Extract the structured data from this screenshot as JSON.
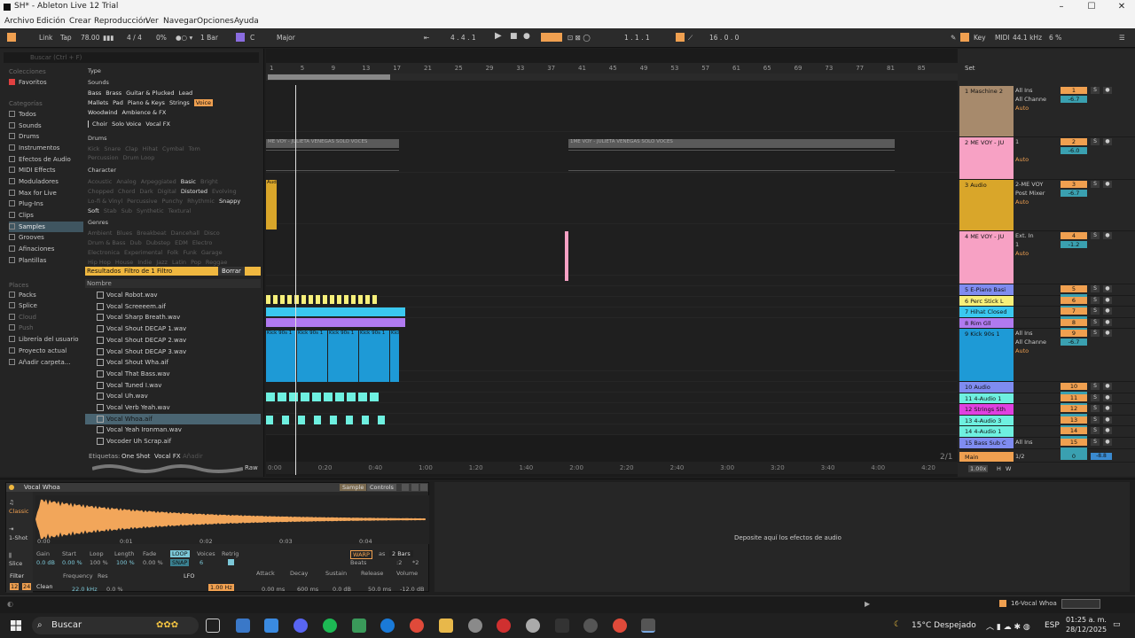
{
  "window": {
    "title": "SH* - Ableton Live 12 Trial"
  },
  "menu": [
    "Archivo",
    "Edición",
    "Crear",
    "Reproducción",
    "Ver",
    "Navegar",
    "Opciones",
    "Ayuda"
  ],
  "control_bar": {
    "link": "Link",
    "tap": "Tap",
    "tempo": "78.00",
    "signature": "4 / 4",
    "swing": "0%",
    "quantize": "1 Bar",
    "key": "C",
    "scale": "Major",
    "position": "4 . 4 . 1",
    "loop_start": "1 . 1 . 1",
    "loop_length": "16 . 0 . 0",
    "key_map": "Key",
    "midi": "MIDI",
    "sample_rate": "44.1 kHz",
    "cpu": "6 %"
  },
  "browser": {
    "search_placeholder": "Buscar (Ctrl + F)",
    "collections_header": "Colecciones",
    "collections": [
      "Favoritos"
    ],
    "categories_header": "Categorías",
    "categories": [
      "Todos",
      "Sounds",
      "Drums",
      "Instrumentos",
      "Efectos de Audio",
      "MIDI Effects",
      "Moduladores",
      "Max for Live",
      "Plug-Ins",
      "Clips",
      "Samples",
      "Grooves",
      "Afinaciones",
      "Plantillas"
    ],
    "selected_category": "Samples",
    "places_header": "Places",
    "places": [
      "Packs",
      "Splice",
      "Cloud",
      "Push",
      "Librería del usuario",
      "Proyecto actual",
      "Añadir carpeta..."
    ],
    "filter_type": "Type",
    "filter_sounds": "Sounds",
    "sounds_rows": [
      [
        "Bass",
        "Brass",
        "Guitar & Plucked",
        "Lead"
      ],
      [
        "Mallets",
        "Pad",
        "Piano & Keys",
        "Strings",
        "Voice"
      ],
      [
        "Woodwind",
        "Ambience & FX"
      ]
    ],
    "voice_sub": [
      "Choir",
      "Solo Voice",
      "Vocal FX"
    ],
    "filter_drums": "Drums",
    "drums_rows": [
      [
        "Kick",
        "Snare",
        "Clap",
        "Hihat",
        "Cymbal",
        "Tom"
      ],
      [
        "Percussion",
        "Drum Loop"
      ]
    ],
    "filter_character": "Character",
    "character_rows": [
      [
        "Acoustic",
        "Analog",
        "Arpeggiated",
        "Basic",
        "Bright"
      ],
      [
        "Chopped",
        "Chord",
        "Dark",
        "Digital",
        "Distorted",
        "Evolving"
      ],
      [
        "Lo-fi & Vinyl",
        "Percussive",
        "Punchy",
        "Rhythmic",
        "Snappy"
      ],
      [
        "Soft",
        "Stab",
        "Sub",
        "Synthetic",
        "Textural"
      ]
    ],
    "filter_genres": "Genres",
    "genres_rows": [
      [
        "Ambient",
        "Blues",
        "Breakbeat",
        "Dancehall",
        "Disco"
      ],
      [
        "Drum & Bass",
        "Dub",
        "Dubstep",
        "EDM",
        "Electro"
      ],
      [
        "Electronica",
        "Experimental",
        "Folk",
        "Funk",
        "Garage"
      ],
      [
        "Hip Hop",
        "House",
        "Indie",
        "Jazz",
        "Latin",
        "Pop",
        "Reggae"
      ]
    ],
    "results_label": "Resultados",
    "filter_count": "Filtro de 1 Filtro",
    "clear_label": "Borrar",
    "name_header": "Nombre",
    "files": [
      "Vocal Robot.wav",
      "Vocal Screeeem.aif",
      "Vocal Sharp Breath.wav",
      "Vocal Shout DECAP 1.wav",
      "Vocal Shout DECAP 2.wav",
      "Vocal Shout DECAP 3.wav",
      "Vocal Shout Wha.aif",
      "Vocal That Bass.wav",
      "Vocal Tuned I.wav",
      "Vocal Uh.wav",
      "Vocal Verb Yeah.wav",
      "Vocal Whoa.aif",
      "Vocal Yeah Ironman.wav",
      "Vocoder Uh Scrap.aif"
    ],
    "selected_file": "Vocal Whoa.aif",
    "tags_label": "Etiquetas:",
    "tags": [
      "One Shot",
      "Vocal FX",
      "Añadir"
    ],
    "raw_label": "Raw"
  },
  "arrangement": {
    "bar_ruler": [
      "1",
      "5",
      "9",
      "13",
      "17",
      "21",
      "25",
      "29",
      "33",
      "37",
      "41",
      "45",
      "49",
      "53",
      "57",
      "61",
      "65",
      "69",
      "73",
      "77",
      "81",
      "85"
    ],
    "time_ruler": [
      "0:00",
      "0:20",
      "0:40",
      "1:00",
      "1:20",
      "1:40",
      "2:00",
      "2:20",
      "2:40",
      "3:00",
      "3:20",
      "3:40",
      "4:00",
      "4:20"
    ],
    "page": "2/1",
    "clip_labels": [
      "ME VOY - JULIETA VENEGAS SOLO VOCES",
      "1ME VOY - JULIETA VENEGAS SOLO VOCES",
      "Aud",
      "Kick 90s 1",
      "Kick 90s 1",
      "Kick 90s 1",
      "Kick 90s 1",
      "Kick 90s 1"
    ]
  },
  "mixer": {
    "set_label": "Set",
    "tracks": [
      {
        "name": "1 Maschine 2",
        "input": "All Ins",
        "channel": "All Channe",
        "mon": "Auto",
        "num": "1",
        "vol": "-6.7",
        "color": "#a78a6c"
      },
      {
        "name": "2 ME VOY - JU",
        "input": "1",
        "channel": "",
        "mon": "Auto",
        "num": "2",
        "vol": "-6.0",
        "color": "#f7a1c4"
      },
      {
        "name": "3 Audio",
        "input": "2-ME VOY",
        "channel": "Post Mixer",
        "mon": "Auto",
        "num": "3",
        "vol": "-6.7",
        "color": "#d9a62a"
      },
      {
        "name": "4 ME VOY - JU",
        "input": "Ext. In",
        "channel": "1",
        "mon": "Auto",
        "num": "4",
        "vol": "-1.2",
        "color": "#f7a1c4"
      },
      {
        "name": "5 E-Piano Basi",
        "input": "",
        "channel": "",
        "mon": "",
        "num": "5",
        "vol": "",
        "color": "#7f8cf0"
      },
      {
        "name": "6 Perc Stick L",
        "input": "",
        "channel": "",
        "mon": "",
        "num": "6",
        "vol": "",
        "color": "#f7f07a"
      },
      {
        "name": "7 Hihat Closed",
        "input": "",
        "channel": "",
        "mon": "",
        "num": "7",
        "vol": "",
        "color": "#3ac8f0"
      },
      {
        "name": "8 Rim Gll",
        "input": "",
        "channel": "",
        "mon": "",
        "num": "8",
        "vol": "",
        "color": "#b07af0"
      },
      {
        "name": "9 Kick 90s 1",
        "input": "All Ins",
        "channel": "All Channe",
        "mon": "Auto",
        "num": "9",
        "vol": "-6.7",
        "color": "#1e9ad6"
      },
      {
        "name": "10 Audio",
        "input": "",
        "channel": "",
        "mon": "",
        "num": "10",
        "vol": "",
        "color": "#7f8cf0"
      },
      {
        "name": "11 4-Audio 1",
        "input": "",
        "channel": "",
        "mon": "",
        "num": "11",
        "vol": "",
        "color": "#6ef0e0"
      },
      {
        "name": "12 Strings Sth",
        "input": "",
        "channel": "",
        "mon": "",
        "num": "12",
        "vol": "",
        "color": "#e040e0"
      },
      {
        "name": "13 4-Audio 3",
        "input": "",
        "channel": "",
        "mon": "",
        "num": "13",
        "vol": "",
        "color": "#6ef0e0"
      },
      {
        "name": "14 4-Audio 1",
        "input": "",
        "channel": "",
        "mon": "",
        "num": "14",
        "vol": "",
        "color": "#6ef0e0"
      },
      {
        "name": "15 Bass Sub C",
        "input": "All Ins",
        "channel": "",
        "mon": "",
        "num": "15",
        "vol": "",
        "color": "#7f8cf0"
      }
    ],
    "main": {
      "name": "Main",
      "value": "1/2",
      "vol": "0",
      "pan": "-8.8"
    },
    "zoom": "1.00x",
    "h_label": "H",
    "w_label": "W"
  },
  "device": {
    "name": "Vocal Whoa",
    "tabs": [
      "Sample",
      "Controls"
    ],
    "modes": [
      "Classic",
      "1-Shot",
      "Slice"
    ],
    "wave_ticks": [
      "0:00",
      "0:01",
      "0:02",
      "0:03",
      "0:04"
    ],
    "params": [
      {
        "label": "Gain",
        "value": "0.0 dB"
      },
      {
        "label": "Start",
        "value": "0.00 %"
      },
      {
        "label": "Loop",
        "value": "100 %"
      },
      {
        "label": "Length",
        "value": "100 %"
      },
      {
        "label": "Fade",
        "value": "0.00 %"
      },
      {
        "label": "Voices",
        "value": "6"
      },
      {
        "label": "Retrig",
        "value": ""
      }
    ],
    "loop_btn": "LOOP",
    "snap_btn": "SNAP",
    "warp_btn": "WARP",
    "warp_mode": "Beats",
    "as_label": "as",
    "bars": "2 Bars",
    "div": ":2",
    "mul": "*2",
    "filter_label": "Filter",
    "filter_type": "Clean",
    "filter_slope": "12",
    "filter_mode": "24",
    "frequency_label": "Frequency",
    "frequency": "22.0 kHz",
    "res_label": "Res",
    "res": "0.0 %",
    "lfo_label": "LFO",
    "lfo_rate": "1.00 Hz",
    "env": [
      {
        "label": "Attack",
        "value": "0.00 ms"
      },
      {
        "label": "Decay",
        "value": "600 ms"
      },
      {
        "label": "Sustain",
        "value": "0.0 dB"
      },
      {
        "label": "Release",
        "value": "50.0 ms"
      },
      {
        "label": "Volume",
        "value": "-12.0 dB"
      }
    ]
  },
  "effects_drop": "Deposite aquí los efectos de audio",
  "status": {
    "track": "16-Vocal Whoa"
  },
  "taskbar": {
    "search": "Buscar",
    "weather": "15°C Despejado",
    "lang": "ESP",
    "time": "01:25 a. m.",
    "date": "28/12/2025"
  }
}
